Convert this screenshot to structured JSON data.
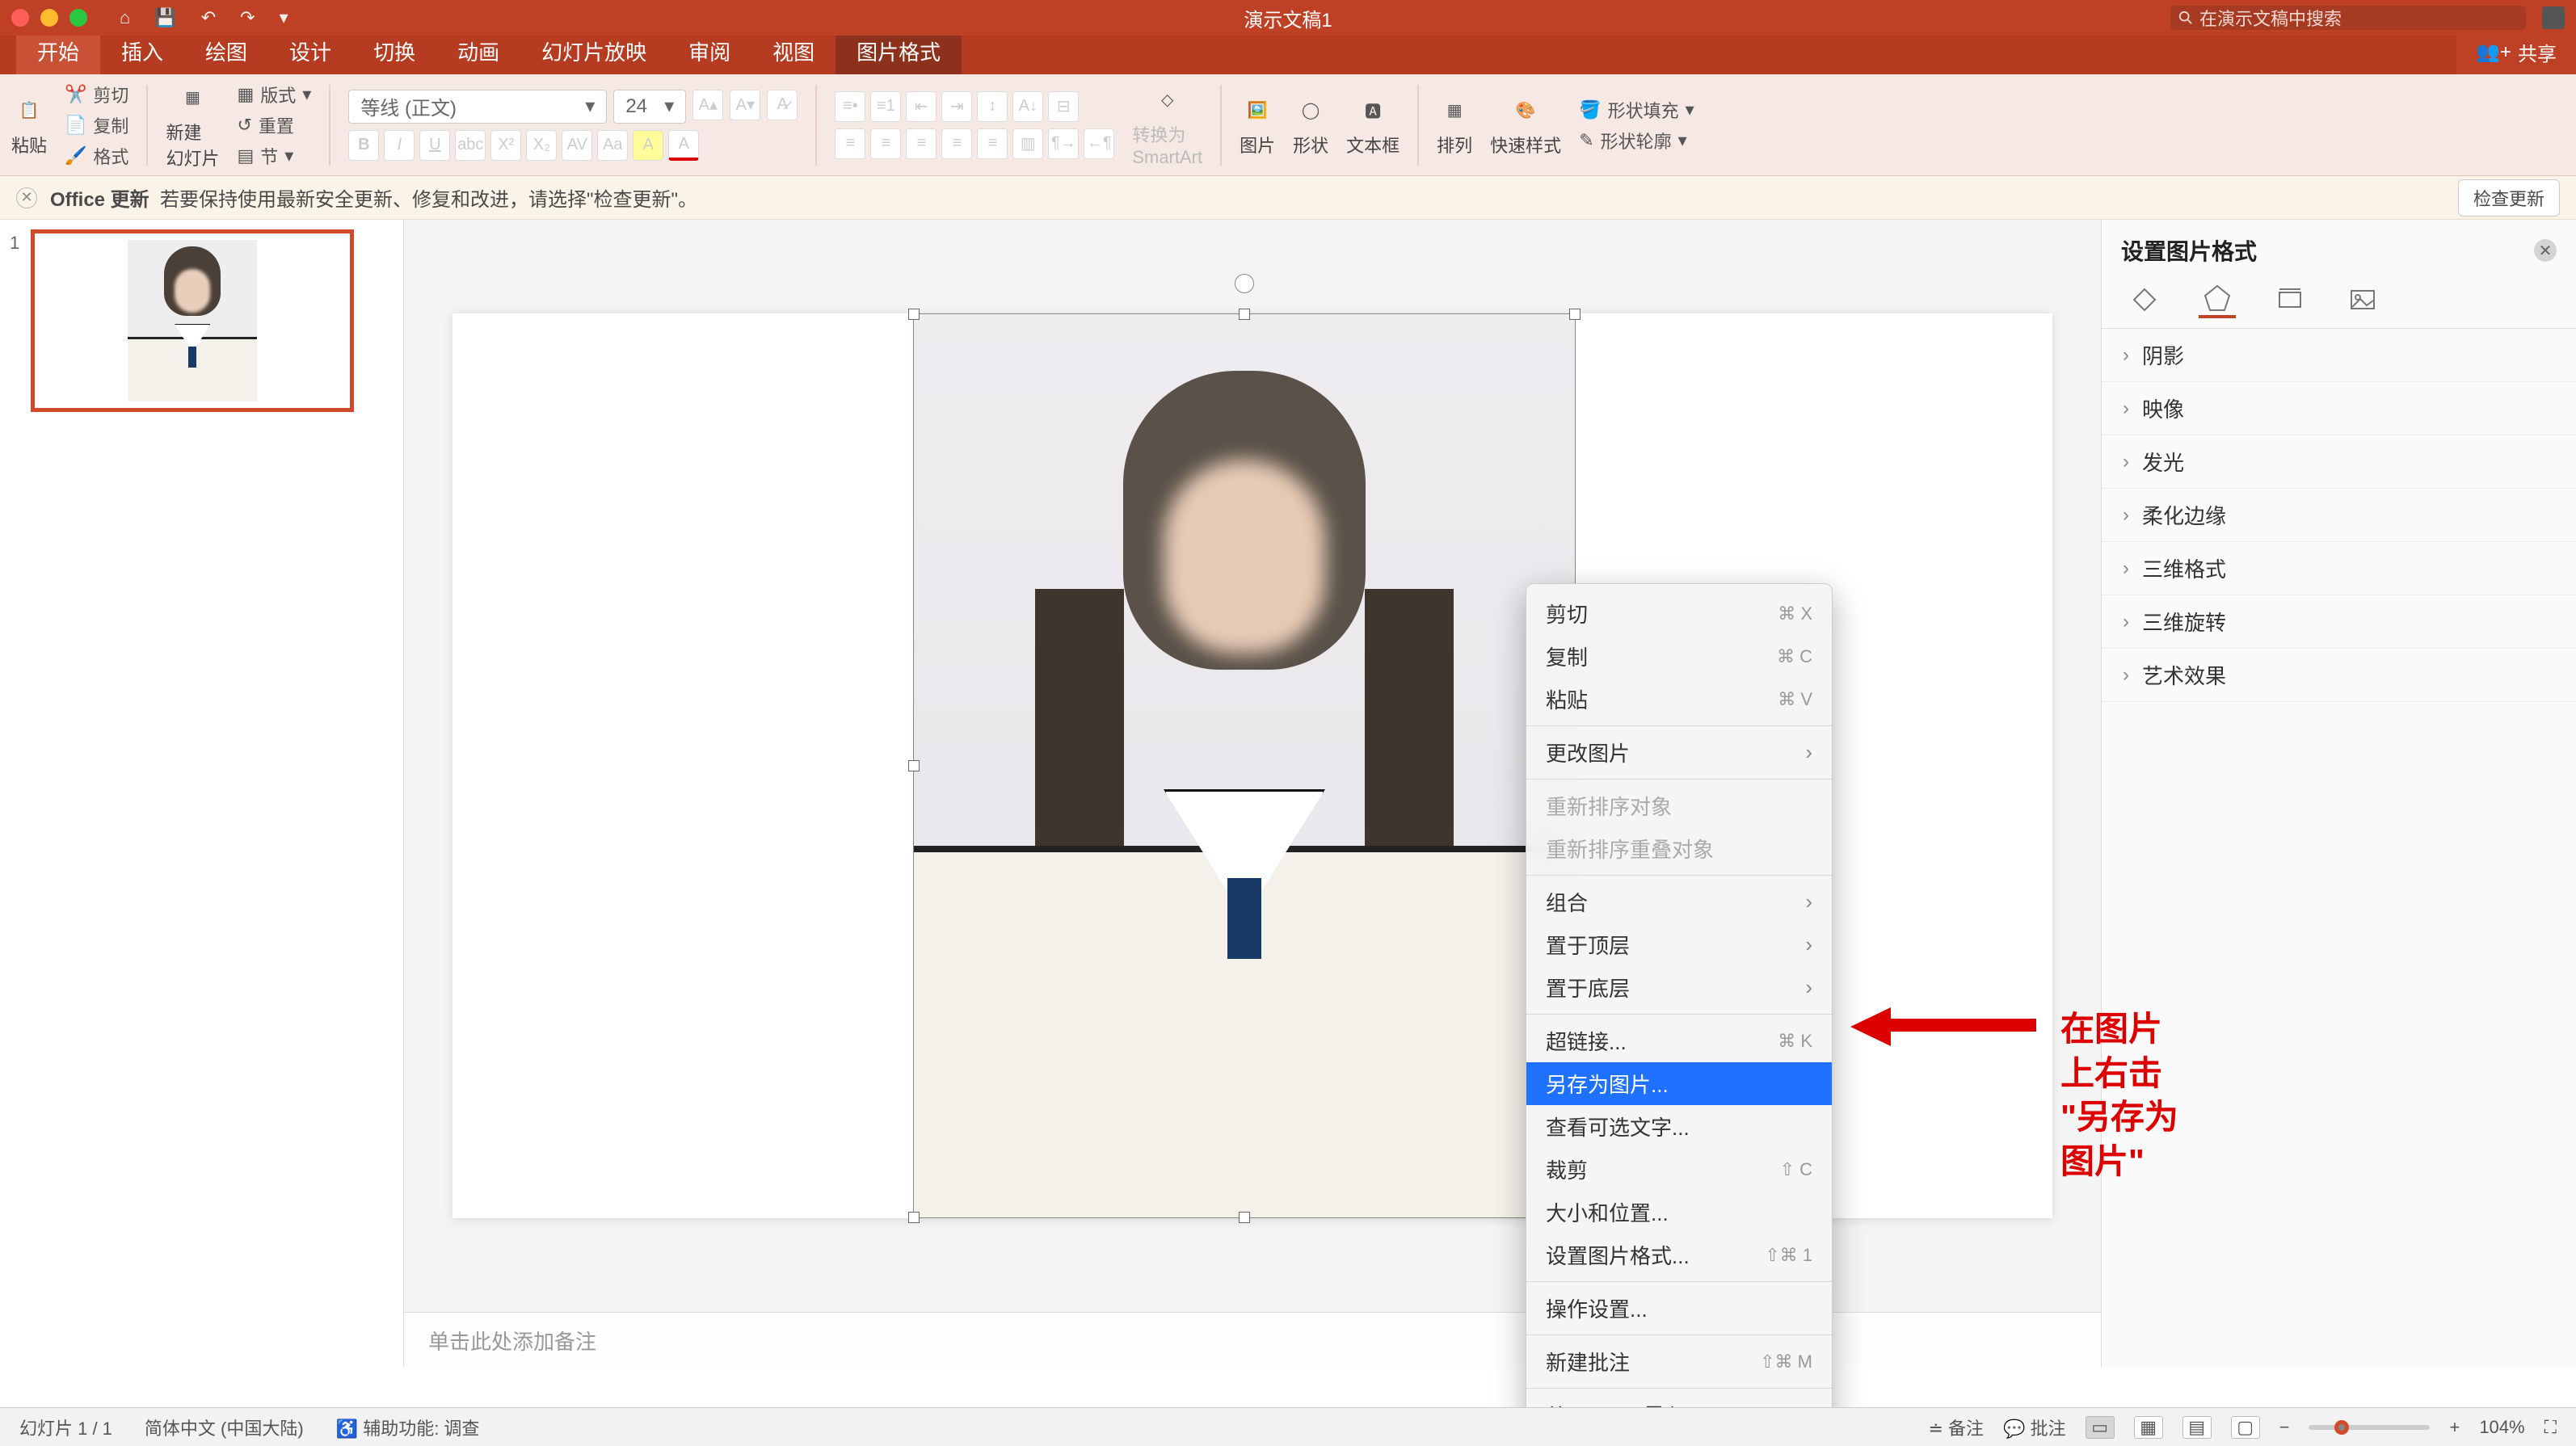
{
  "titlebar": {
    "doc_title": "演示文稿1",
    "search_placeholder": "在演示文稿中搜索"
  },
  "qat": {
    "home": "⌂",
    "save": "💾",
    "undo": "↶",
    "redo": "↷",
    "more": "▾"
  },
  "tabs": {
    "items": [
      "开始",
      "插入",
      "绘图",
      "设计",
      "切换",
      "动画",
      "幻灯片放映",
      "审阅",
      "视图",
      "图片格式"
    ],
    "active_index": 0,
    "sub_index": 9,
    "share_label": "共享"
  },
  "ribbon": {
    "paste": "粘贴",
    "cut": "剪切",
    "copy": "复制",
    "format": "格式",
    "new_slide": "新建\n幻灯片",
    "layout": "版式",
    "reset": "重置",
    "section": "节",
    "font_name": "等线 (正文)",
    "font_size": "24",
    "convert": "转换为\nSmartArt",
    "picture": "图片",
    "shape": "形状",
    "textbox": "文本框",
    "arrange": "排列",
    "quickstyle": "快速样式",
    "shape_fill": "形状填充",
    "shape_outline": "形状轮廓"
  },
  "updatebar": {
    "prefix": "Office 更新",
    "msg": "若要保持使用最新安全更新、修复和改进，请选择\"检查更新\"。",
    "button": "检查更新"
  },
  "thumbnails": {
    "slide1_num": "1"
  },
  "context_menu": {
    "cut": "剪切",
    "cut_sc": "⌘ X",
    "copy": "复制",
    "copy_sc": "⌘ C",
    "paste": "粘贴",
    "paste_sc": "⌘ V",
    "change_pic": "更改图片",
    "reorder": "重新排序对象",
    "reorder_overlap": "重新排序重叠对象",
    "group": "组合",
    "bring_front": "置于顶层",
    "send_back": "置于底层",
    "hyperlink": "超链接...",
    "hyperlink_sc": "⌘ K",
    "save_as_pic": "另存为图片...",
    "alttext": "查看可选文字...",
    "crop": "裁剪",
    "crop_sc": "⇧ C",
    "size_pos": "大小和位置...",
    "format_pic": "设置图片格式...",
    "format_pic_sc": "⇧⌘ 1",
    "action": "操作设置...",
    "new_comment": "新建批注",
    "new_comment_sc": "⇧⌘ M",
    "import_iphone": "从 iPhone 导入"
  },
  "annotation": {
    "line1": "在图片上右击",
    "line2": "\"另存为图片\""
  },
  "notes_placeholder": "单击此处添加备注",
  "sidepanel": {
    "title": "设置图片格式",
    "items": [
      "阴影",
      "映像",
      "发光",
      "柔化边缘",
      "三维格式",
      "三维旋转",
      "艺术效果"
    ]
  },
  "statusbar": {
    "slide": "幻灯片 1 / 1",
    "lang": "简体中文 (中国大陆)",
    "a11y": "辅助功能: 调查",
    "notes": "备注",
    "comments": "批注",
    "zoom": "104%"
  }
}
